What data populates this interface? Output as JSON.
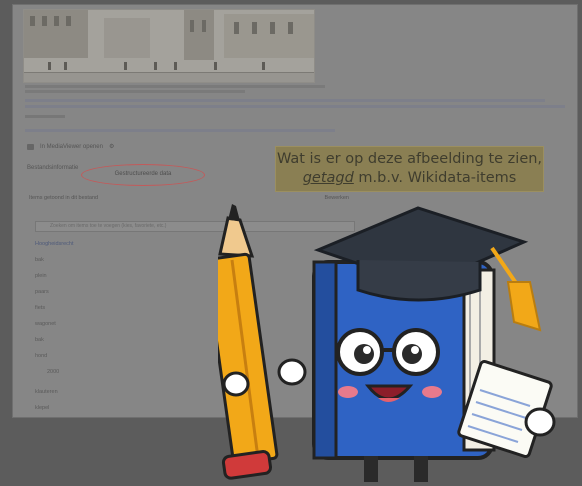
{
  "callout": {
    "line1": "Wat is er op deze afbeelding te zien,",
    "word_tagged": "getagd",
    "line2_rest": " m.b.v. Wikidata-items"
  },
  "tabs": {
    "file_info": "Bestandsinformatie",
    "structured": "Gestructureerde data"
  },
  "page": {
    "open_view_label": "In MediaViewer openen",
    "depicts_heading": "Items getoond in dit bestand",
    "depicts_edit": "Bewerken",
    "search_placeholder": "Zoeken om items toe te voegen (kies, favoriete, etc.)",
    "depicts_rows": [
      "Hoogheidsrecht",
      "bak",
      "plein",
      "paars",
      "fiets",
      "wagonet",
      "bak",
      "hond",
      "2000",
      "klauteren",
      "klepel"
    ]
  },
  "colors": {
    "callout_bg": "#8a7f53",
    "highlight_ring": "#c25a5a",
    "book_blue": "#2f63c4",
    "pencil_yellow": "#f0a81e"
  },
  "icons": [
    "pencil-mascot",
    "book-mascot",
    "graduation-cap-icon",
    "notepad-icon"
  ]
}
